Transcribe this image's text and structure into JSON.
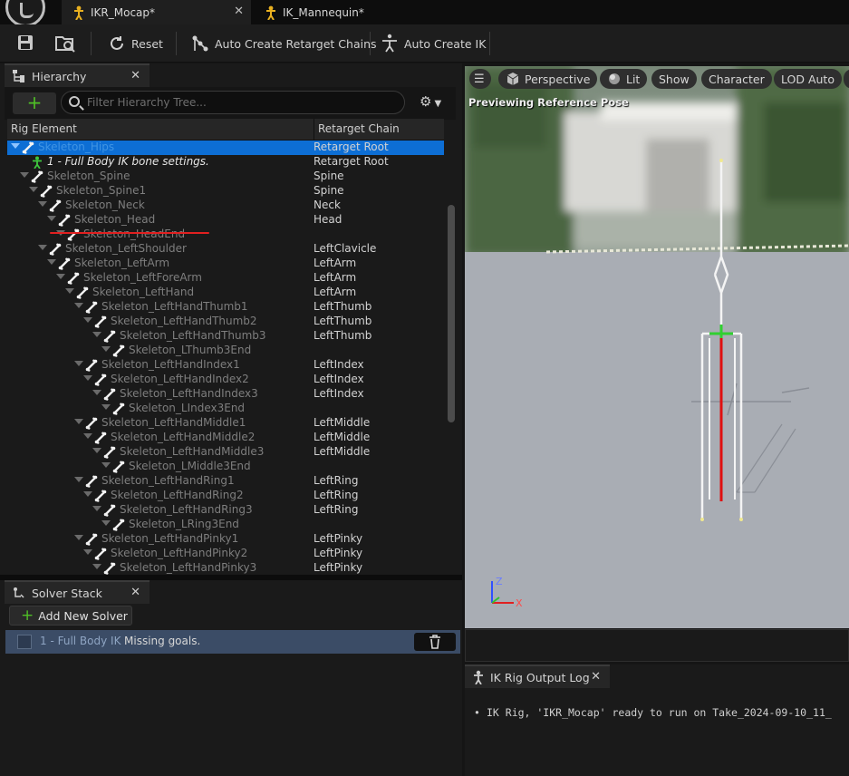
{
  "tabs": [
    {
      "label": "IKR_Mocap*",
      "active": true
    },
    {
      "label": "IK_Mannequin*",
      "active": false
    }
  ],
  "toolbar": {
    "reset": "Reset",
    "auto_chains": "Auto Create Retarget Chains",
    "auto_ik": "Auto Create IK"
  },
  "hierarchy": {
    "title": "Hierarchy",
    "filter_placeholder": "Filter Hierarchy Tree...",
    "col_element": "Rig Element",
    "col_chain": "Retarget Chain",
    "rows": [
      {
        "depth": 0,
        "name": "Skeleton_Hips",
        "chain": "Retarget Root",
        "selected": true,
        "kind": "bone"
      },
      {
        "depth": 1,
        "name": "1 - Full Body IK bone settings.",
        "chain": "Retarget Root",
        "kind": "solver"
      },
      {
        "depth": 1,
        "name": "Skeleton_Spine",
        "chain": "Spine",
        "kind": "bone"
      },
      {
        "depth": 2,
        "name": "Skeleton_Spine1",
        "chain": "Spine",
        "kind": "bone"
      },
      {
        "depth": 3,
        "name": "Skeleton_Neck",
        "chain": "Neck",
        "kind": "bone"
      },
      {
        "depth": 4,
        "name": "Skeleton_Head",
        "chain": "Head",
        "kind": "bone"
      },
      {
        "depth": 5,
        "name": "Skeleton_HeadEnd",
        "chain": "",
        "kind": "bone"
      },
      {
        "depth": 3,
        "name": "Skeleton_LeftShoulder",
        "chain": "LeftClavicle",
        "kind": "bone"
      },
      {
        "depth": 4,
        "name": "Skeleton_LeftArm",
        "chain": "LeftArm",
        "kind": "bone"
      },
      {
        "depth": 5,
        "name": "Skeleton_LeftForeArm",
        "chain": "LeftArm",
        "kind": "bone"
      },
      {
        "depth": 6,
        "name": "Skeleton_LeftHand",
        "chain": "LeftArm",
        "kind": "bone"
      },
      {
        "depth": 7,
        "name": "Skeleton_LeftHandThumb1",
        "chain": "LeftThumb",
        "kind": "bone"
      },
      {
        "depth": 8,
        "name": "Skeleton_LeftHandThumb2",
        "chain": "LeftThumb",
        "kind": "bone"
      },
      {
        "depth": 9,
        "name": "Skeleton_LeftHandThumb3",
        "chain": "LeftThumb",
        "kind": "bone"
      },
      {
        "depth": 10,
        "name": "Skeleton_LThumb3End",
        "chain": "",
        "kind": "bone"
      },
      {
        "depth": 7,
        "name": "Skeleton_LeftHandIndex1",
        "chain": "LeftIndex",
        "kind": "bone"
      },
      {
        "depth": 8,
        "name": "Skeleton_LeftHandIndex2",
        "chain": "LeftIndex",
        "kind": "bone"
      },
      {
        "depth": 9,
        "name": "Skeleton_LeftHandIndex3",
        "chain": "LeftIndex",
        "kind": "bone"
      },
      {
        "depth": 10,
        "name": "Skeleton_LIndex3End",
        "chain": "",
        "kind": "bone"
      },
      {
        "depth": 7,
        "name": "Skeleton_LeftHandMiddle1",
        "chain": "LeftMiddle",
        "kind": "bone"
      },
      {
        "depth": 8,
        "name": "Skeleton_LeftHandMiddle2",
        "chain": "LeftMiddle",
        "kind": "bone"
      },
      {
        "depth": 9,
        "name": "Skeleton_LeftHandMiddle3",
        "chain": "LeftMiddle",
        "kind": "bone"
      },
      {
        "depth": 10,
        "name": "Skeleton_LMiddle3End",
        "chain": "",
        "kind": "bone"
      },
      {
        "depth": 7,
        "name": "Skeleton_LeftHandRing1",
        "chain": "LeftRing",
        "kind": "bone"
      },
      {
        "depth": 8,
        "name": "Skeleton_LeftHandRing2",
        "chain": "LeftRing",
        "kind": "bone"
      },
      {
        "depth": 9,
        "name": "Skeleton_LeftHandRing3",
        "chain": "LeftRing",
        "kind": "bone"
      },
      {
        "depth": 10,
        "name": "Skeleton_LRing3End",
        "chain": "",
        "kind": "bone"
      },
      {
        "depth": 7,
        "name": "Skeleton_LeftHandPinky1",
        "chain": "LeftPinky",
        "kind": "bone"
      },
      {
        "depth": 8,
        "name": "Skeleton_LeftHandPinky2",
        "chain": "LeftPinky",
        "kind": "bone"
      },
      {
        "depth": 9,
        "name": "Skeleton_LeftHandPinky3",
        "chain": "LeftPinky",
        "kind": "bone"
      }
    ]
  },
  "solver_stack": {
    "title": "Solver Stack",
    "add_label": "Add New Solver",
    "solver_name": "1 - Full Body IK",
    "solver_status": "Missing goals."
  },
  "viewport": {
    "perspective": "Perspective",
    "lit": "Lit",
    "show": "Show",
    "character": "Character",
    "lod": "LOD Auto",
    "preview": "Previewing Reference Pose",
    "axis_z": "Z",
    "axis_x": "X"
  },
  "log": {
    "title": "IK Rig Output Log",
    "message": "IK Rig, 'IKR_Mocap' ready to run on Take_2024-09-10_11_"
  },
  "colors": {
    "selection": "#0d6ed4",
    "accent_green": "#4fbf26",
    "annotation_red": "#e02020"
  }
}
